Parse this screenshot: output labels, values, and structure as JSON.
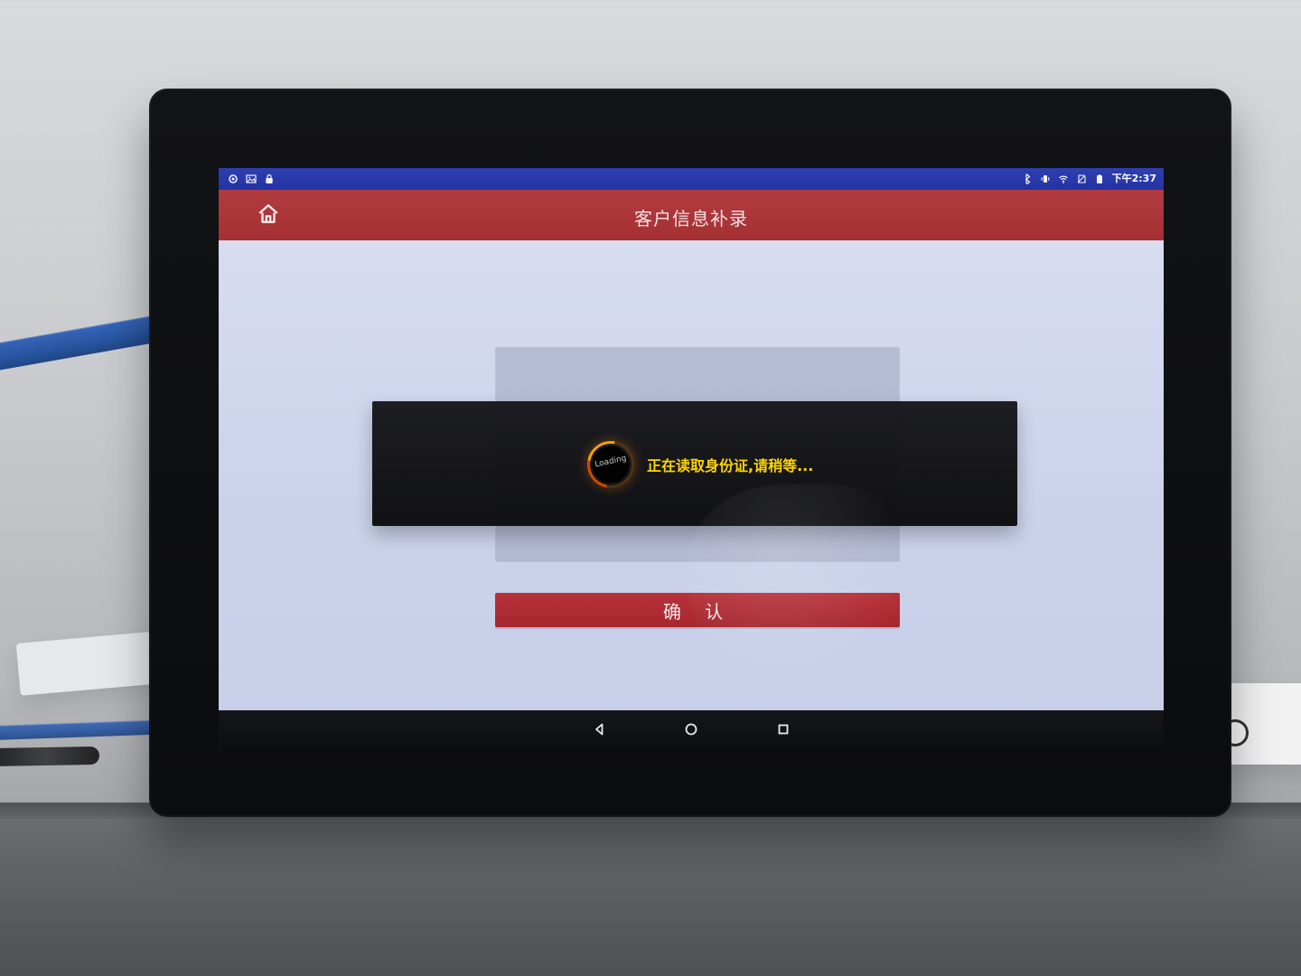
{
  "status_bar": {
    "time": "下午2:37",
    "icons_left": [
      "settings-icon",
      "image-icon",
      "lock-icon"
    ],
    "icons_right": [
      "bluetooth-icon",
      "vibrate-icon",
      "wifi-icon",
      "no-sim-icon",
      "battery-icon"
    ]
  },
  "app_bar": {
    "home_icon": "home-icon",
    "title": "客户信息补录"
  },
  "dialog": {
    "spinner_label": "Loading",
    "message": "正在读取身份证,请稍等..."
  },
  "main": {
    "confirm_label": "确 认"
  },
  "nav_bar": {
    "back_icon": "back-icon",
    "home_icon": "circle-home-icon",
    "recents_icon": "recents-icon"
  },
  "colors": {
    "status_bar": "#2433a3",
    "app_bar": "#a53034",
    "confirm": "#a6272f",
    "dialog_text": "#ffd400"
  }
}
